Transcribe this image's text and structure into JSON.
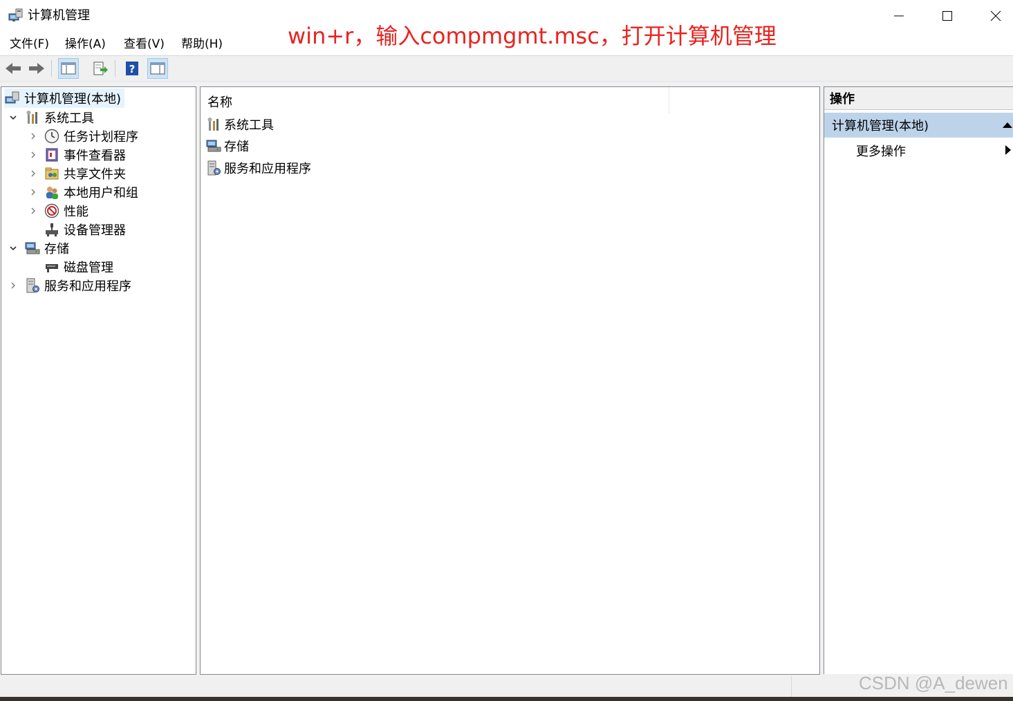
{
  "window": {
    "title": "计算机管理",
    "icon": "computer-management-icon"
  },
  "annotation": "win+r，输入compmgmt.msc，打开计算机管理",
  "menu": [
    "文件(F)",
    "操作(A)",
    "查看(V)",
    "帮助(H)"
  ],
  "toolbar": [
    "back-arrow-icon",
    "forward-arrow-icon",
    "show-hide-console-tree-icon",
    "export-list-icon",
    "help-icon",
    "show-hide-action-pane-icon"
  ],
  "tree": {
    "root": "计算机管理(本地)",
    "items": [
      {
        "label": "系统工具",
        "icon": "system-tools-icon",
        "expanded": true
      },
      {
        "label": "任务计划程序",
        "icon": "clock-icon"
      },
      {
        "label": "事件查看器",
        "icon": "event-viewer-icon"
      },
      {
        "label": "共享文件夹",
        "icon": "shared-folder-icon"
      },
      {
        "label": "本地用户和组",
        "icon": "users-icon"
      },
      {
        "label": "性能",
        "icon": "performance-icon"
      },
      {
        "label": "设备管理器",
        "icon": "device-manager-icon"
      },
      {
        "label": "存储",
        "icon": "storage-icon",
        "expanded": true
      },
      {
        "label": "磁盘管理",
        "icon": "disk-icon"
      },
      {
        "label": "服务和应用程序",
        "icon": "services-icon",
        "expanded": false
      }
    ]
  },
  "list": {
    "column_name": "名称",
    "rows": [
      "系统工具",
      "存储",
      "服务和应用程序"
    ]
  },
  "actions": {
    "header": "操作",
    "group": "计算机管理(本地)",
    "more": "更多操作"
  },
  "watermark": "CSDN @A_dewen"
}
